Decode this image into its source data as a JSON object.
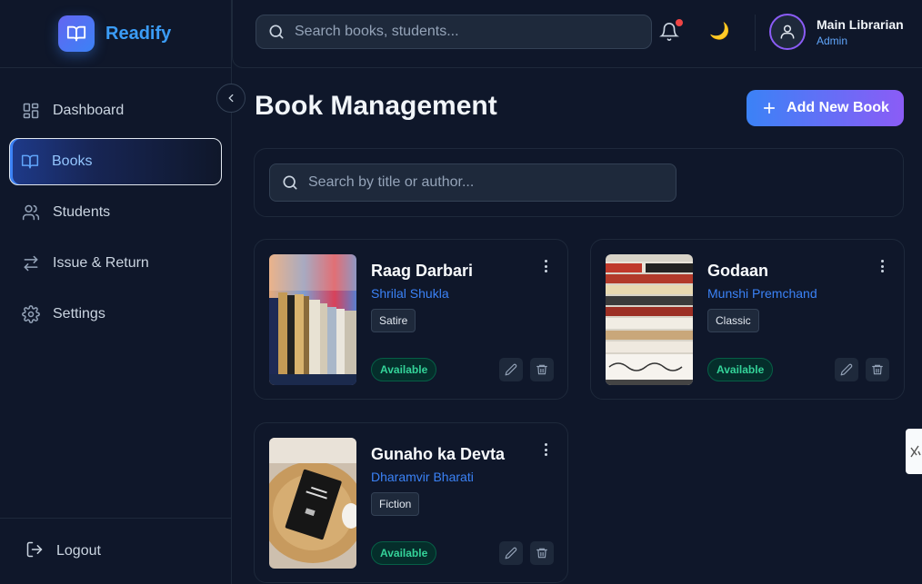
{
  "brand": {
    "name": "Readify"
  },
  "sidebar": {
    "items": [
      {
        "label": "Dashboard",
        "icon": "dashboard-icon",
        "active": false
      },
      {
        "label": "Books",
        "icon": "book-open-icon",
        "active": true
      },
      {
        "label": "Students",
        "icon": "users-icon",
        "active": false
      },
      {
        "label": "Issue & Return",
        "icon": "arrows-exchange-icon",
        "active": false
      },
      {
        "label": "Settings",
        "icon": "gear-icon",
        "active": false
      }
    ],
    "logout_label": "Logout"
  },
  "header": {
    "search_placeholder": "Search books, students...",
    "user_name": "Main Librarian",
    "user_role": "Admin",
    "has_notification": true
  },
  "main": {
    "title": "Book Management",
    "add_button_label": "Add New Book",
    "search_placeholder": "Search by title or author..."
  },
  "books": [
    {
      "title": "Raag Darbari",
      "author": "Shrilal Shukla",
      "genre": "Satire",
      "status": "Available"
    },
    {
      "title": "Godaan",
      "author": "Munshi Premchand",
      "genre": "Classic",
      "status": "Available"
    },
    {
      "title": "Gunaho ka Devta",
      "author": "Dharamvir Bharati",
      "genre": "Fiction",
      "status": "Available"
    }
  ],
  "colors": {
    "background": "#0f172a",
    "accent": "#3b82f6",
    "accent_gradient_end": "#8b5cf6",
    "status_available": "#34d399",
    "notification": "#ef4444"
  }
}
